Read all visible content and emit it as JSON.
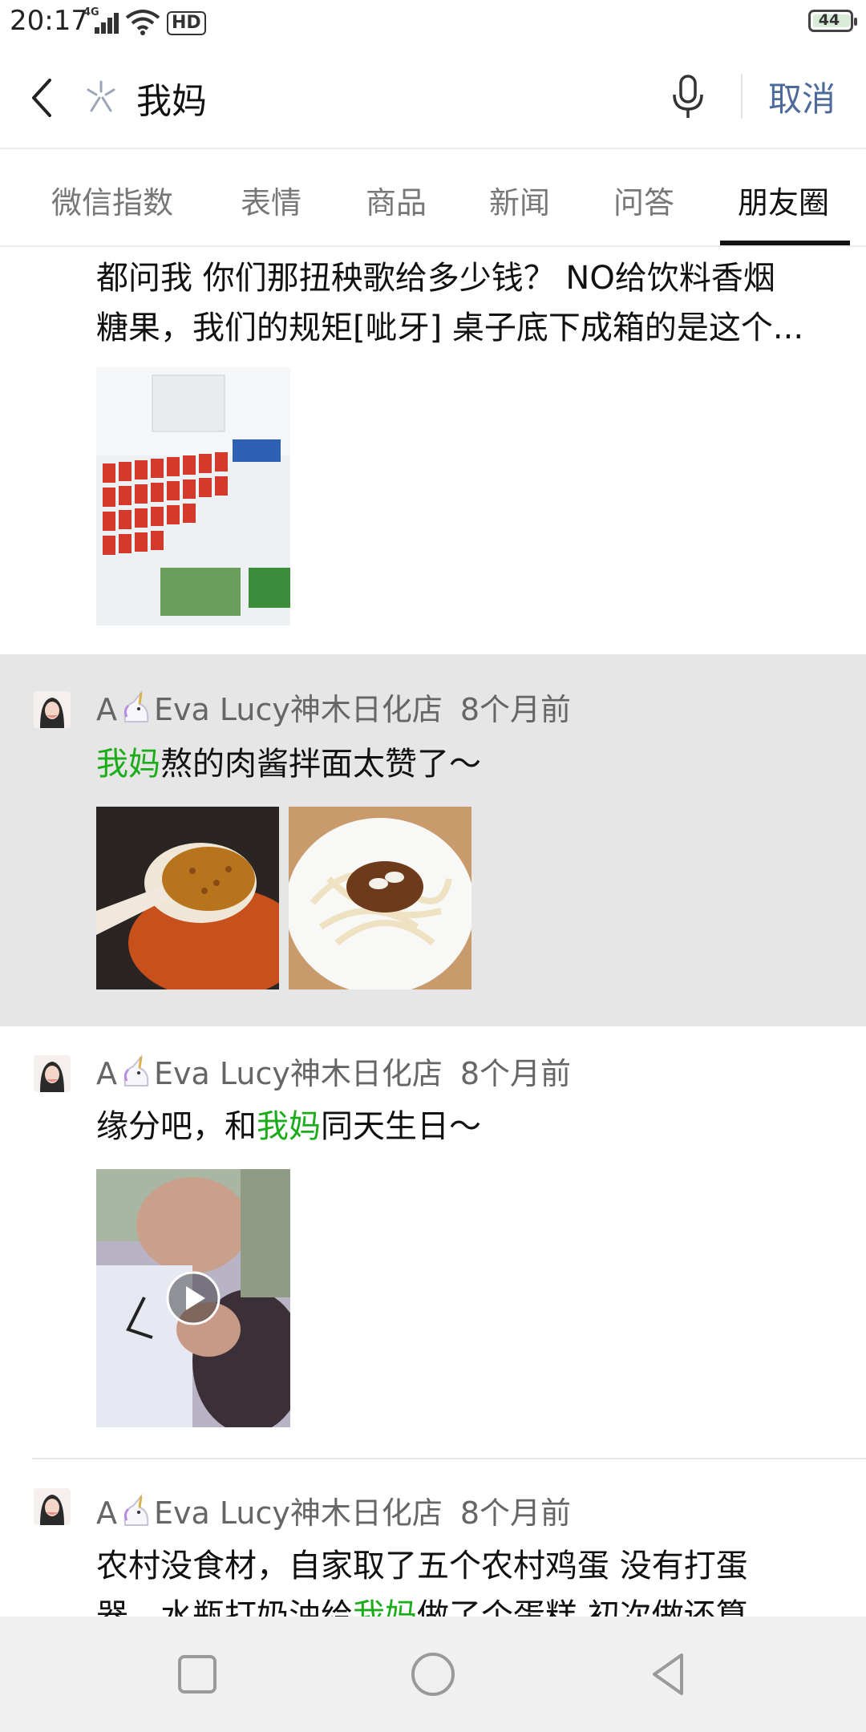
{
  "status_bar": {
    "time": "20:17",
    "network": "4G",
    "hd": "HD",
    "battery": "44"
  },
  "search": {
    "query": "我妈",
    "cancel": "取消"
  },
  "tabs": [
    {
      "label": "微信指数"
    },
    {
      "label": "表情"
    },
    {
      "label": "商品"
    },
    {
      "label": "新闻"
    },
    {
      "label": "问答"
    },
    {
      "label": "朋友圈",
      "active": true
    }
  ],
  "posts": [
    {
      "text_line1": "都问我 你们那扭秧歌给多少钱？ NO给饮料香烟",
      "text_line2": "糖果，我们的规矩[呲牙] 桌子底下成箱的是这个..."
    },
    {
      "author_prefix": "A",
      "author_name": "Eva Lucy神木日化店",
      "time": "8个月前",
      "text_highlight": "我妈",
      "text_rest": "熬的肉酱拌面太赞了～"
    },
    {
      "author_prefix": "A",
      "author_name": "Eva Lucy神木日化店",
      "time": "8个月前",
      "text_before": "缘分吧，和",
      "text_highlight": "我妈",
      "text_after": "同天生日～"
    },
    {
      "author_prefix": "A",
      "author_name": "Eva Lucy神木日化店",
      "time": "8个月前",
      "text_line1": "农村没食材，自家取了五个农村鸡蛋 没有打蛋",
      "text_line2_before": "器，水瓶打奶油给",
      "text_highlight": "我妈",
      "text_line2_after": "做了个蛋糕 初次做还算"
    }
  ]
}
